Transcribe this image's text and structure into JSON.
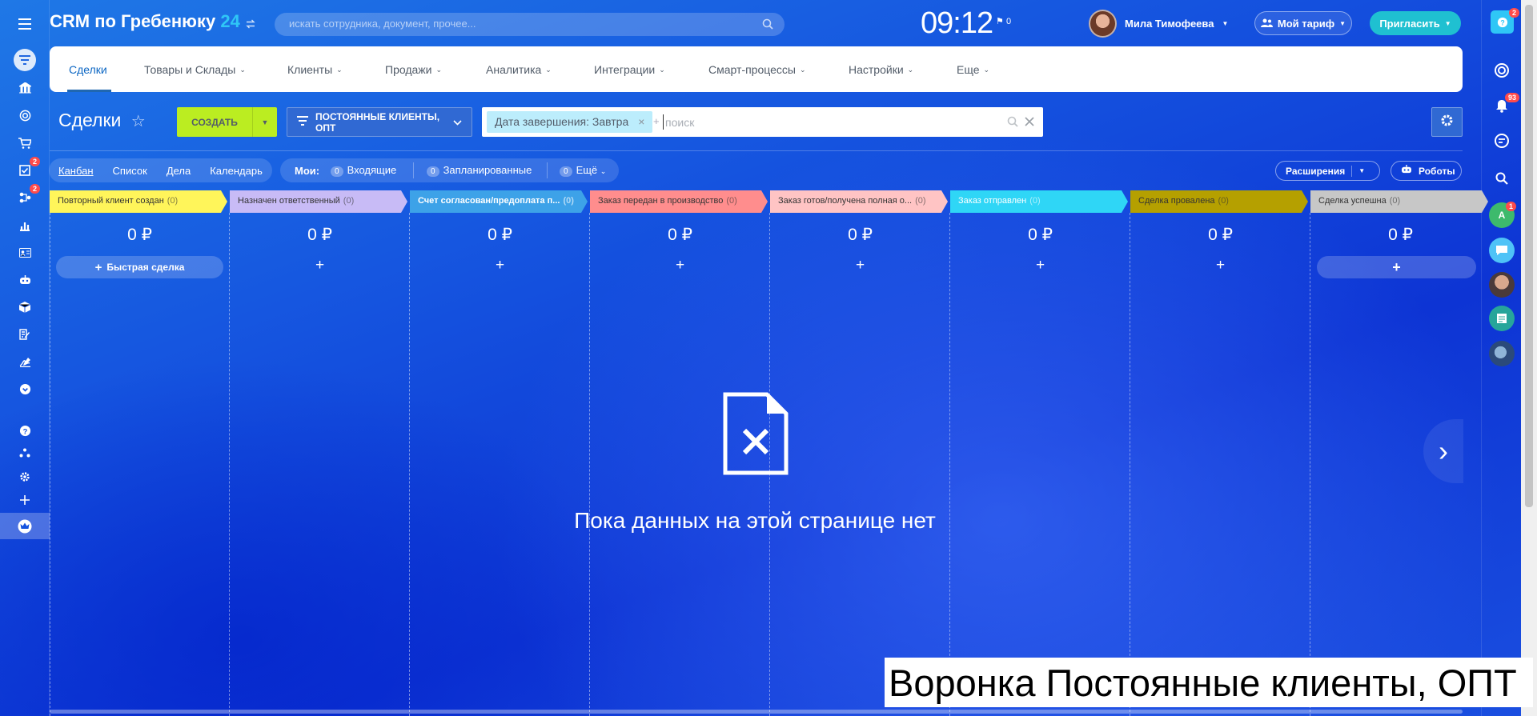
{
  "app": {
    "title": "CRM по Гребенюку",
    "title_num": "24"
  },
  "search": {
    "placeholder": "искать сотрудника, документ, прочее..."
  },
  "clock": {
    "time": "09:12",
    "flag_count": "0"
  },
  "user": {
    "name": "Мила Тимофеева"
  },
  "buttons": {
    "tariff": "Мой тариф",
    "invite": "Пригласить",
    "create": "СОЗДАТЬ",
    "extensions": "Расширения",
    "robots": "Роботы"
  },
  "menu": {
    "items": [
      "Сделки",
      "Товары и Склады",
      "Клиенты",
      "Продажи",
      "Аналитика",
      "Интеграции",
      "Смарт-процессы",
      "Настройки",
      "Еще"
    ]
  },
  "page": {
    "title": "Сделки"
  },
  "filter": {
    "preset": "ПОСТОЯННЫЕ КЛИЕНТЫ, ОПТ",
    "chip": "Дата завершения: Завтра",
    "chip_close": "×",
    "plus": "+",
    "search_placeholder": "поиск"
  },
  "views": {
    "items": [
      "Канбан",
      "Список",
      "Дела",
      "Календарь"
    ]
  },
  "my": {
    "label": "Мои:",
    "incoming_count": "0",
    "incoming": "Входящие",
    "planned_count": "0",
    "planned": "Запланированные",
    "more_count": "0",
    "more": "Ещё"
  },
  "stages": [
    {
      "name": "Повторный клиент создан",
      "count": "(0)",
      "color": "#fff55a",
      "sum": "0 ₽"
    },
    {
      "name": "Назначен ответственный",
      "count": "(0)",
      "color": "#c8bbf6",
      "sum": "0 ₽"
    },
    {
      "name": "Счет согласован/предоплата п...",
      "count": "(0)",
      "color": "#3da2e8",
      "sum": "0 ₽"
    },
    {
      "name": "Заказ передан в производство",
      "count": "(0)",
      "color": "#ff8d8d",
      "sum": "0 ₽"
    },
    {
      "name": "Заказ готов/получена полная о...",
      "count": "(0)",
      "color": "#ffc4c4",
      "sum": "0 ₽"
    },
    {
      "name": "Заказ отправлен",
      "count": "(0)",
      "color": "#2fd6f6",
      "sum": "0 ₽"
    },
    {
      "name": "Сделка провалена",
      "count": "(0)",
      "color": "#b5a000",
      "sum": "0 ₽"
    },
    {
      "name": "Сделка успешна",
      "count": "(0)",
      "color": "#c7c7c7",
      "sum": "0 ₽"
    }
  ],
  "quick_deal": "Быстрая сделка",
  "add": "+",
  "empty": {
    "text": "Пока данных на этой странице нет"
  },
  "badges": {
    "tasks": "2",
    "rpa": "2",
    "help": "2",
    "notifications": "93",
    "contact": "1"
  },
  "avatar_letter": "А",
  "caption": "Воронка Постоянные клиенты, ОПТ"
}
